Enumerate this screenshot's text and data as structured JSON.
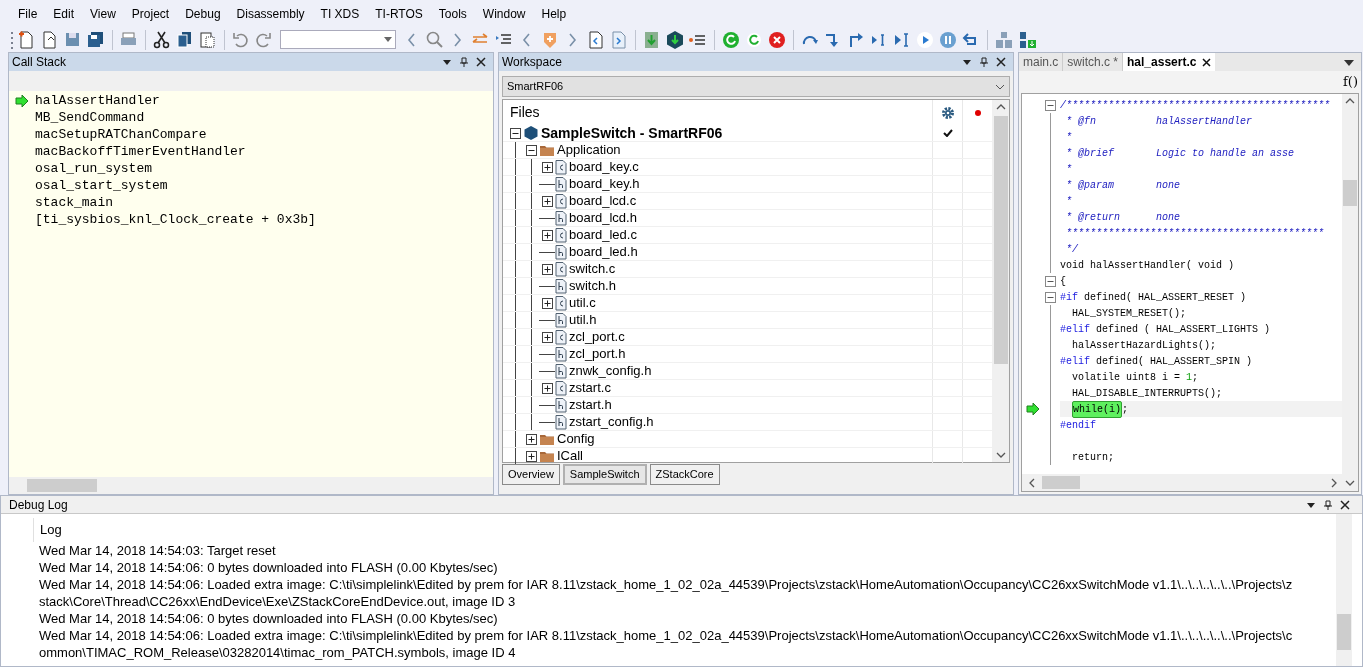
{
  "menu": [
    "File",
    "Edit",
    "View",
    "Project",
    "Debug",
    "Disassembly",
    "TI XDS",
    "TI-RTOS",
    "Tools",
    "Window",
    "Help"
  ],
  "call_stack": {
    "title": "Call Stack",
    "frames": [
      {
        "label": "halAssertHandler",
        "current": true
      },
      {
        "label": "MB_SendCommand",
        "current": false
      },
      {
        "label": "macSetupRATChanCompare",
        "current": false
      },
      {
        "label": "macBackoffTimerEventHandler",
        "current": false
      },
      {
        "label": "osal_run_system",
        "current": false
      },
      {
        "label": "osal_start_system",
        "current": false
      },
      {
        "label": "stack_main",
        "current": false
      },
      {
        "label": "[ti_sysbios_knl_Clock_create + 0x3b]",
        "current": false
      }
    ]
  },
  "workspace": {
    "title": "Workspace",
    "configuration": "SmartRF06",
    "column": "Files",
    "tree": {
      "label": "SampleSwitch - SmartRF06",
      "kind": "project",
      "expanded": true,
      "checked": true,
      "children": [
        {
          "label": "Application",
          "kind": "folder",
          "expanded": true,
          "checked": false,
          "children": [
            {
              "label": "board_key.c",
              "kind": "c",
              "expanded": false,
              "checked": false
            },
            {
              "label": "board_key.h",
              "kind": "h",
              "checked": false
            },
            {
              "label": "board_lcd.c",
              "kind": "c",
              "expanded": false,
              "checked": false
            },
            {
              "label": "board_lcd.h",
              "kind": "h",
              "checked": false
            },
            {
              "label": "board_led.c",
              "kind": "c",
              "expanded": false,
              "checked": false
            },
            {
              "label": "board_led.h",
              "kind": "h",
              "checked": false
            },
            {
              "label": "switch.c",
              "kind": "c",
              "expanded": false,
              "checked": false
            },
            {
              "label": "switch.h",
              "kind": "h",
              "checked": false
            },
            {
              "label": "util.c",
              "kind": "c",
              "expanded": false,
              "checked": false
            },
            {
              "label": "util.h",
              "kind": "h",
              "checked": false
            },
            {
              "label": "zcl_port.c",
              "kind": "c",
              "expanded": false,
              "checked": false
            },
            {
              "label": "zcl_port.h",
              "kind": "h",
              "checked": false
            },
            {
              "label": "znwk_config.h",
              "kind": "h",
              "checked": false
            },
            {
              "label": "zstart.c",
              "kind": "c",
              "expanded": false,
              "checked": false
            },
            {
              "label": "zstart.h",
              "kind": "h",
              "checked": false
            },
            {
              "label": "zstart_config.h",
              "kind": "h",
              "checked": false
            }
          ]
        },
        {
          "label": "Config",
          "kind": "folder",
          "expanded": false,
          "checked": false
        },
        {
          "label": "ICall",
          "kind": "folder",
          "expanded": false,
          "checked": false
        }
      ]
    },
    "tabs": [
      {
        "label": "Overview",
        "selected": false
      },
      {
        "label": "SampleSwitch",
        "selected": true
      },
      {
        "label": "ZStackCore",
        "selected": false
      }
    ]
  },
  "editor": {
    "tabs": [
      {
        "label": "main.c",
        "selected": false
      },
      {
        "label": "switch.c *",
        "selected": false
      },
      {
        "label": "hal_assert.c",
        "selected": true
      }
    ],
    "function_button": "f()",
    "lines": [
      {
        "fold_open": true,
        "segments": [
          {
            "kind": "comment",
            "text": "/********************************************"
          }
        ]
      },
      {
        "segments": [
          {
            "kind": "comment",
            "text": " * @fn          halAssertHandler"
          }
        ]
      },
      {
        "segments": [
          {
            "kind": "comment",
            "text": " *"
          }
        ]
      },
      {
        "segments": [
          {
            "kind": "comment",
            "text": " * @brief       Logic to handle an asse"
          }
        ]
      },
      {
        "segments": [
          {
            "kind": "comment",
            "text": " *"
          }
        ]
      },
      {
        "segments": [
          {
            "kind": "comment",
            "text": " * @param       none"
          }
        ]
      },
      {
        "segments": [
          {
            "kind": "comment",
            "text": " *"
          }
        ]
      },
      {
        "segments": [
          {
            "kind": "comment",
            "text": " * @return      none"
          }
        ]
      },
      {
        "segments": [
          {
            "kind": "comment",
            "text": " *******************************************"
          }
        ]
      },
      {
        "segments": [
          {
            "kind": "comment",
            "text": " */"
          }
        ]
      },
      {
        "segments": [
          {
            "kind": "plain",
            "text": "void halAssertHandler( void )"
          }
        ]
      },
      {
        "fold_open": true,
        "segments": [
          {
            "kind": "plain",
            "text": "{"
          }
        ]
      },
      {
        "fold_open": true,
        "segments": [
          {
            "kind": "directive",
            "text": "#if"
          },
          {
            "kind": "plain",
            "text": " defined( HAL_ASSERT_RESET )"
          }
        ]
      },
      {
        "segments": [
          {
            "kind": "plain",
            "text": "  HAL_SYSTEM_RESET();"
          }
        ]
      },
      {
        "segments": [
          {
            "kind": "directive",
            "text": "#elif"
          },
          {
            "kind": "plain",
            "text": " defined ( HAL_ASSERT_LIGHTS )"
          }
        ]
      },
      {
        "segments": [
          {
            "kind": "plain",
            "text": "  halAssertHazardLights();"
          }
        ]
      },
      {
        "segments": [
          {
            "kind": "directive",
            "text": "#elif"
          },
          {
            "kind": "plain",
            "text": " defined( HAL_ASSERT_SPIN )"
          }
        ]
      },
      {
        "segments": [
          {
            "kind": "plain",
            "text": "  volatile uint8 i = "
          },
          {
            "kind": "number",
            "text": "1"
          },
          {
            "kind": "plain",
            "text": ";"
          }
        ]
      },
      {
        "segments": [
          {
            "kind": "plain",
            "text": "  HAL_DISABLE_INTERRUPTS();"
          }
        ]
      },
      {
        "current": true,
        "indented": true,
        "segments": [
          {
            "kind": "highlight",
            "text": "while(i)"
          },
          {
            "kind": "plain",
            "text": ";"
          }
        ]
      },
      {
        "segments": [
          {
            "kind": "directive",
            "text": "#endif"
          }
        ]
      },
      {
        "kind": "blank"
      },
      {
        "segments": [
          {
            "kind": "plain",
            "text": "  return;"
          }
        ]
      }
    ]
  },
  "debug_log": {
    "title": "Debug Log",
    "column": "Log",
    "entries": [
      "Wed Mar 14, 2018 14:54:03: Target reset",
      "Wed Mar 14, 2018 14:54:06: 0 bytes downloaded into FLASH (0.00 Kbytes/sec)",
      "Wed Mar 14, 2018 14:54:06: Loaded extra image: C:\\ti\\simplelink\\Edited by prem for IAR 8.11\\zstack_home_1_02_02a_44539\\Projects\\zstack\\HomeAutomation\\Occupancy\\CC26xxSwitchMode v1.1\\..\\..\\..\\..\\..\\Projects\\zstack\\Core\\Thread\\CC26xx\\EndDevice\\Exe\\ZStackCoreEndDevice.out, image ID 3",
      "Wed Mar 14, 2018 14:54:06: 0 bytes downloaded into FLASH (0.00 Kbytes/sec)",
      "Wed Mar 14, 2018 14:54:06: Loaded extra image: C:\\ti\\simplelink\\Edited by prem for IAR 8.11\\zstack_home_1_02_02a_44539\\Projects\\zstack\\HomeAutomation\\Occupancy\\CC26xxSwitchMode v1.1\\..\\..\\..\\..\\..\\Projects\\common\\TIMAC_ROM_Release\\03282014\\timac_rom_PATCH.symbols, image ID 4"
    ]
  }
}
